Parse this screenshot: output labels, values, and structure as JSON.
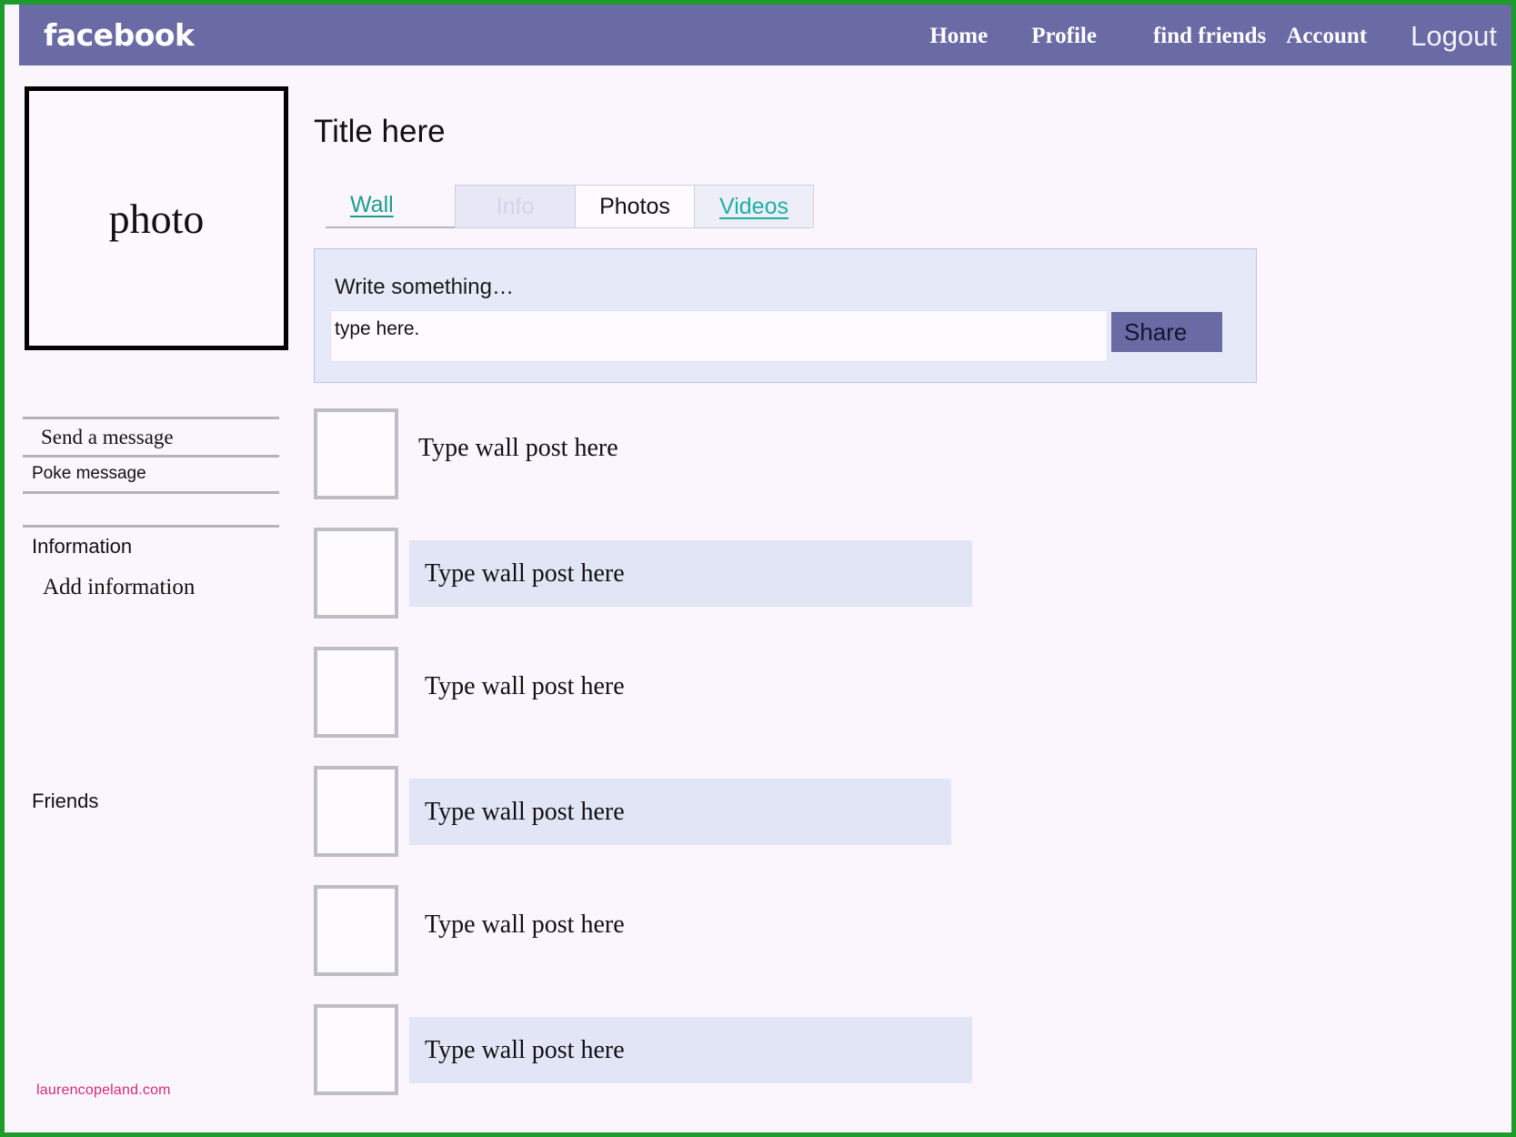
{
  "theme": {
    "brand_purple": "#6a6aa5",
    "page_border_green": "#1d9b2b",
    "page_bg": "#fbf6fd",
    "link_teal": "#1d9d8e",
    "tint_blue": "#e2e5f6",
    "watermark_pink": "#d62a7a"
  },
  "topbar": {
    "brand": "facebook",
    "nav": [
      {
        "label": "Home"
      },
      {
        "label": "Profile"
      },
      {
        "label": "find friends"
      },
      {
        "label": "Account"
      },
      {
        "label": "Logout"
      }
    ]
  },
  "sidebar": {
    "photo_label": "photo",
    "send_message": "Send a message",
    "poke_message": "Poke message",
    "information_heading": "Information",
    "add_information": "Add information",
    "friends_heading": "Friends",
    "watermark": "laurencopeland.com"
  },
  "main": {
    "title": "Title here",
    "tabs": [
      {
        "label": "Wall",
        "state": "link"
      },
      {
        "label": "Info",
        "state": "disabled"
      },
      {
        "label": "Photos",
        "state": "normal"
      },
      {
        "label": "Videos",
        "state": "link"
      }
    ],
    "composer": {
      "prompt": "Write something…",
      "input_value": "type here.",
      "share_label": "Share"
    },
    "posts": [
      {
        "text": "Type wall post here",
        "tinted": false
      },
      {
        "text": "Type wall post here",
        "tinted": true
      },
      {
        "text": "Type wall post here",
        "tinted": false
      },
      {
        "text": "Type wall post here",
        "tinted": true
      },
      {
        "text": "Type wall post here",
        "tinted": false
      },
      {
        "text": "Type wall post here",
        "tinted": true
      }
    ]
  }
}
